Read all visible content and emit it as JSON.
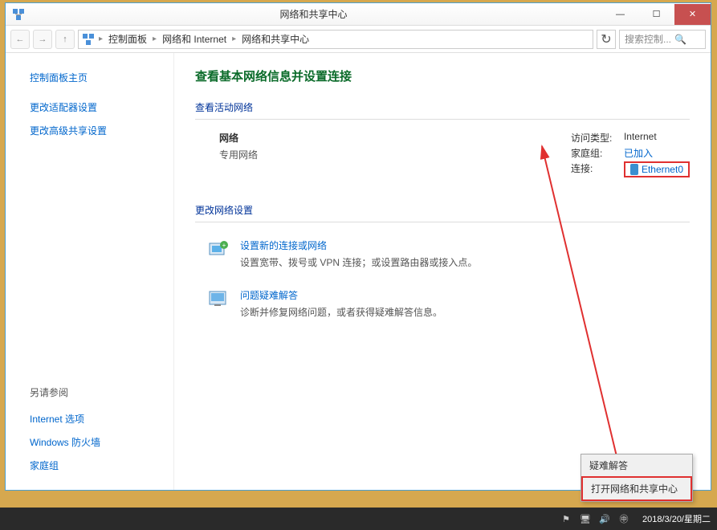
{
  "window": {
    "title": "网络和共享中心"
  },
  "breadcrumb": {
    "items": [
      "控制面板",
      "网络和 Internet",
      "网络和共享中心"
    ],
    "search_placeholder": "搜索控制..."
  },
  "sidebar": {
    "home": "控制面板主页",
    "links": [
      "更改适配器设置",
      "更改高级共享设置"
    ],
    "see_also_title": "另请参阅",
    "see_also": [
      "Internet 选项",
      "Windows 防火墙",
      "家庭组"
    ]
  },
  "main": {
    "page_title": "查看基本网络信息并设置连接",
    "active_section": "查看活动网络",
    "network": {
      "name": "网络",
      "type": "专用网络",
      "access_label": "访问类型:",
      "access_value": "Internet",
      "homegroup_label": "家庭组:",
      "homegroup_value": "已加入",
      "conn_label": "连接:",
      "conn_value": "Ethernet0"
    },
    "change_section": "更改网络设置",
    "settings": [
      {
        "title": "设置新的连接或网络",
        "desc": "设置宽带、拨号或 VPN 连接；或设置路由器或接入点。"
      },
      {
        "title": "问题疑难解答",
        "desc": "诊断并修复网络问题，或者获得疑难解答信息。"
      }
    ]
  },
  "context_menu": {
    "items": [
      "疑难解答",
      "打开网络和共享中心"
    ]
  },
  "taskbar": {
    "clock": "2018/3/20/星期二"
  }
}
